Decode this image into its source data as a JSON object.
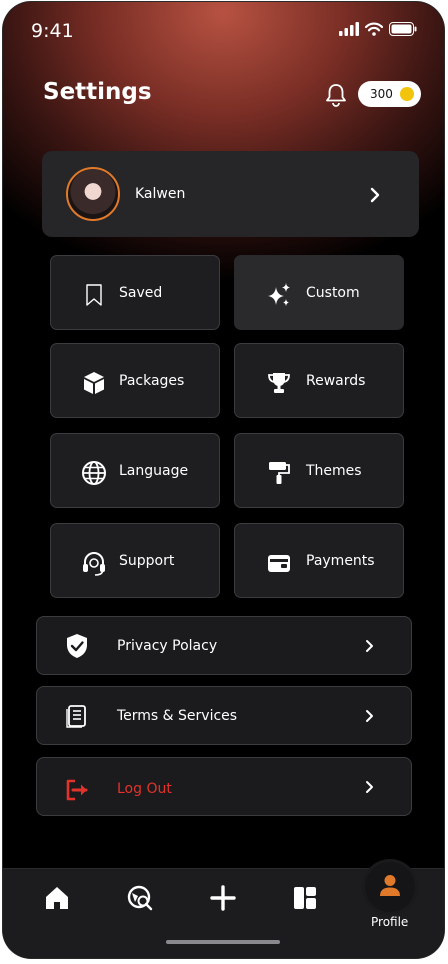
{
  "status": {
    "time": "9:41"
  },
  "header": {
    "title": "Settings",
    "coins": "300"
  },
  "profile": {
    "name": "Kalwen"
  },
  "tiles": [
    {
      "label": "Saved",
      "icon": "bookmark-icon"
    },
    {
      "label": "Custom",
      "icon": "sparkles-icon"
    },
    {
      "label": "Packages",
      "icon": "package-icon"
    },
    {
      "label": "Rewards",
      "icon": "trophy-icon"
    },
    {
      "label": "Language",
      "icon": "globe-icon"
    },
    {
      "label": "Themes",
      "icon": "paint-roller-icon"
    },
    {
      "label": "Support",
      "icon": "headset-icon"
    },
    {
      "label": "Payments",
      "icon": "wallet-icon"
    }
  ],
  "rows": [
    {
      "label": "Privacy Polacy",
      "icon": "shield-check-icon"
    },
    {
      "label": "Terms & Services",
      "icon": "document-icon"
    },
    {
      "label": "Log Out",
      "icon": "logout-icon"
    }
  ],
  "tabbar": {
    "items": [
      "home-icon",
      "discover-icon",
      "add-icon",
      "dashboard-icon",
      "profile-icon"
    ],
    "active_label": "Profile"
  },
  "colors": {
    "accent": "#e07a2a",
    "danger": "#e2332b",
    "coin": "#f2c40c"
  }
}
